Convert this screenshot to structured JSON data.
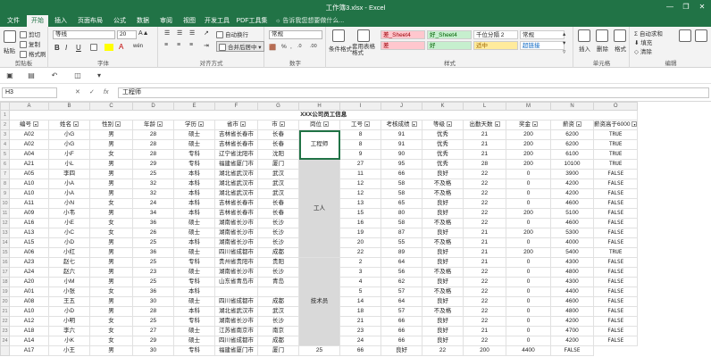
{
  "window": {
    "title": "工作簿3.xlsx - Excel",
    "minimize": "—",
    "restore": "❐",
    "close": "✕"
  },
  "tabs": [
    "文件",
    "开始",
    "插入",
    "页面布局",
    "公式",
    "数据",
    "审阅",
    "视图",
    "开发工具",
    "PDF工具集"
  ],
  "active_tab": "开始",
  "tell_me": "告诉我您想要做什么...",
  "ribbon": {
    "clipboard": {
      "label": "剪贴板",
      "paste": "粘贴",
      "cut": "剪切",
      "copy": "复制",
      "format_painter": "格式刷"
    },
    "font": {
      "label": "字体",
      "name": "等线",
      "size": "20",
      "bold": "B",
      "italic": "I",
      "underline": "U",
      "font_color": "A",
      "phonetic": "wén"
    },
    "alignment": {
      "label": "对齐方式",
      "wrap": "自动换行",
      "merge": "合并后居中"
    },
    "number": {
      "label": "数字",
      "format": "常规",
      "currency": "%",
      "comma": ",",
      "dec_inc": ".0",
      "dec_dec": ".00"
    },
    "styles": {
      "label": "样式",
      "conditional": "条件格式",
      "table": "套用表格格式",
      "cells": [
        {
          "text": "差_Sheet4",
          "bg": "#ffc7ce",
          "color": "#9c0006"
        },
        {
          "text": "好_Sheet4",
          "bg": "#c6efce",
          "color": "#006100"
        },
        {
          "text": "千位分隔 2",
          "bg": "#ffffff",
          "color": "#222222"
        },
        {
          "text": "常规",
          "bg": "#ffffff",
          "color": "#222222"
        },
        {
          "text": "差",
          "bg": "#ffc7ce",
          "color": "#9c0006"
        },
        {
          "text": "好",
          "bg": "#c6efce",
          "color": "#006100"
        },
        {
          "text": "适中",
          "bg": "#ffeb9c",
          "color": "#9c6500"
        },
        {
          "text": "超链接",
          "bg": "#ffffff",
          "color": "#0563c1"
        }
      ]
    },
    "cells": {
      "label": "单元格",
      "insert": "插入",
      "delete": "删除",
      "format": "格式"
    },
    "editing": {
      "label": "编辑",
      "autosum": "自动求和",
      "fill": "填充",
      "clear": "清除",
      "sort": "排序和筛选",
      "find": "查找和选择"
    }
  },
  "formula_bar": {
    "name_box": "H3",
    "cancel": "✕",
    "enter": "✓",
    "fx": "fx",
    "content": "工程师"
  },
  "sheet": {
    "columns": [
      "A",
      "B",
      "C",
      "D",
      "E",
      "F",
      "G",
      "H",
      "I",
      "J",
      "K",
      "L",
      "M",
      "N",
      "O"
    ],
    "row_numbers": [
      "1",
      "2",
      "3",
      "4",
      "5",
      "6",
      "7",
      "8",
      "9",
      "10",
      "11",
      "12",
      "13",
      "14",
      "15",
      "16",
      "17",
      "18",
      "19",
      "20",
      "21",
      "22",
      "23",
      "24"
    ],
    "banner": "XXX公司员工信息",
    "headers": [
      "编号",
      "姓名",
      "性别",
      "年龄",
      "学历",
      "省市",
      "市",
      "岗位",
      "工号",
      "考核成绩",
      "等级",
      "出勤天数",
      "奖金",
      "薪资",
      "薪资高于6000"
    ],
    "job_groups": [
      {
        "text": "工程师",
        "rows": 3
      },
      {
        "text": "工人",
        "rows": 10
      },
      {
        "text": "技术员",
        "rows": 9
      }
    ],
    "rows": [
      [
        "A02",
        "小G",
        "男",
        "28",
        "硕士",
        "吉林省长春市",
        "长春",
        "8",
        "91",
        "优秀",
        "21",
        "200",
        "6200",
        "TRUE"
      ],
      [
        "A02",
        "小G",
        "男",
        "28",
        "硕士",
        "吉林省长春市",
        "长春",
        "8",
        "91",
        "优秀",
        "21",
        "200",
        "6200",
        "TRUE"
      ],
      [
        "A04",
        "小F",
        "女",
        "28",
        "专科",
        "辽宁省沈阳市",
        "沈阳",
        "9",
        "90",
        "优秀",
        "21",
        "200",
        "6100",
        "TRUE"
      ],
      [
        "A21",
        "小L",
        "男",
        "29",
        "专科",
        "福建省厦门市",
        "厦门",
        "27",
        "95",
        "优秀",
        "28",
        "200",
        "10100",
        "TRUE"
      ],
      [
        "A05",
        "李四",
        "男",
        "25",
        "本科",
        "湖北省武汉市",
        "武汉",
        "11",
        "66",
        "良好",
        "22",
        "0",
        "3900",
        "FALSE"
      ],
      [
        "A10",
        "小A",
        "男",
        "32",
        "本科",
        "湖北省武汉市",
        "武汉",
        "12",
        "58",
        "不及格",
        "22",
        "0",
        "4200",
        "FALSE"
      ],
      [
        "A10",
        "小A",
        "男",
        "32",
        "本科",
        "湖北省武汉市",
        "武汉",
        "12",
        "58",
        "不及格",
        "22",
        "0",
        "4200",
        "FALSE"
      ],
      [
        "A11",
        "小N",
        "女",
        "24",
        "本科",
        "吉林省长春市",
        "长春",
        "13",
        "65",
        "良好",
        "22",
        "0",
        "4600",
        "FALSE"
      ],
      [
        "A09",
        "小韦",
        "男",
        "34",
        "本科",
        "吉林省长春市",
        "长春",
        "15",
        "80",
        "良好",
        "22",
        "200",
        "5100",
        "FALSE"
      ],
      [
        "A16",
        "小E",
        "女",
        "36",
        "硕士",
        "湖南省长沙市",
        "长沙",
        "16",
        "58",
        "不及格",
        "22",
        "0",
        "4600",
        "FALSE"
      ],
      [
        "A13",
        "小C",
        "女",
        "26",
        "硕士",
        "湖南省长沙市",
        "长沙",
        "19",
        "87",
        "良好",
        "21",
        "200",
        "5300",
        "FALSE"
      ],
      [
        "A15",
        "小D",
        "男",
        "25",
        "本科",
        "湖南省长沙市",
        "长沙",
        "20",
        "55",
        "不及格",
        "21",
        "0",
        "4000",
        "FALSE"
      ],
      [
        "A06",
        "小红",
        "男",
        "36",
        "硕士",
        "四川省成都市",
        "成都",
        "22",
        "89",
        "良好",
        "21",
        "200",
        "5400",
        "TRUE"
      ],
      [
        "A23",
        "赵七",
        "男",
        "25",
        "专科",
        "贵州省贵阳市",
        "贵阳",
        "2",
        "64",
        "良好",
        "21",
        "0",
        "4300",
        "FALSE"
      ],
      [
        "A24",
        "赵六",
        "男",
        "23",
        "硕士",
        "湖南省长沙市",
        "长沙",
        "3",
        "56",
        "不及格",
        "22",
        "0",
        "4800",
        "FALSE"
      ],
      [
        "A20",
        "小M",
        "男",
        "25",
        "专科",
        "山东省青岛市",
        "青岛",
        "4",
        "62",
        "良好",
        "22",
        "0",
        "4300",
        "FALSE"
      ],
      [
        "A01",
        "小张",
        "女",
        "36",
        "本科",
        "",
        "",
        "5",
        "57",
        "不及格",
        "22",
        "0",
        "4400",
        "FALSE"
      ],
      [
        "A08",
        "王五",
        "男",
        "30",
        "硕士",
        "四川省成都市",
        "成都",
        "14",
        "64",
        "良好",
        "22",
        "0",
        "4600",
        "FALSE"
      ],
      [
        "A10",
        "小D",
        "男",
        "28",
        "本科",
        "湖北省武汉市",
        "武汉",
        "18",
        "57",
        "不及格",
        "22",
        "0",
        "4800",
        "FALSE"
      ],
      [
        "A12",
        "小明",
        "女",
        "25",
        "专科",
        "湖南省长沙市",
        "长沙",
        "21",
        "66",
        "良好",
        "22",
        "0",
        "4200",
        "FALSE"
      ],
      [
        "A18",
        "李六",
        "女",
        "27",
        "硕士",
        "江苏省南京市",
        "南京",
        "23",
        "66",
        "良好",
        "21",
        "0",
        "4700",
        "FALSE"
      ],
      [
        "A14",
        "小K",
        "女",
        "29",
        "硕士",
        "四川省成都市",
        "成都",
        "24",
        "66",
        "良好",
        "22",
        "0",
        "4200",
        "FALSE"
      ],
      [
        "A17",
        "小王",
        "男",
        "30",
        "专科",
        "福建省厦门市",
        "厦门",
        "25",
        "66",
        "良好",
        "22",
        "200",
        "4400",
        "FALSE"
      ]
    ]
  }
}
